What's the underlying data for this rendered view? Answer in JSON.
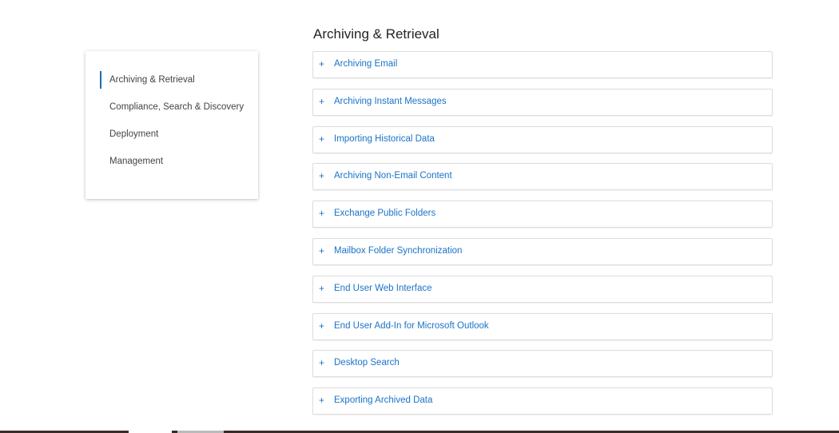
{
  "sidebar": {
    "items": [
      {
        "label": "Archiving & Retrieval",
        "active": true
      },
      {
        "label": "Compliance, Search & Discovery"
      },
      {
        "label": "Deployment"
      },
      {
        "label": "Management"
      }
    ]
  },
  "main": {
    "title": "Archiving & Retrieval",
    "expand_icon": "+",
    "sections": [
      "Archiving Email",
      "Archiving Instant Messages",
      "Importing Historical Data",
      "Archiving Non-Email Content",
      "Exchange Public Folders",
      "Mailbox Folder Synchronization",
      "End User Web Interface",
      "End User Add-In for Microsoft Outlook",
      "Desktop Search",
      "Exporting Archived Data"
    ]
  },
  "colors": {
    "accent": "#1a73c8",
    "footer": "#3b2b27"
  }
}
